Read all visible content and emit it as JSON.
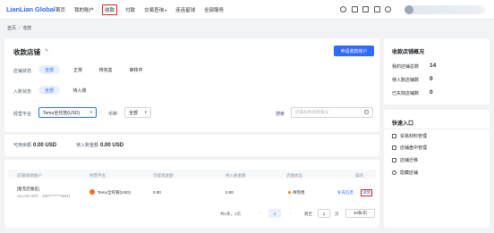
{
  "header": {
    "logo": "LianLian Global",
    "nav": [
      {
        "label": "首页"
      },
      {
        "label": "我的账户"
      },
      {
        "label": "收款"
      },
      {
        "label": "付款"
      },
      {
        "label": "交易查询",
        "caret": "▾"
      },
      {
        "label": "连连星球"
      },
      {
        "label": "全部服务"
      }
    ]
  },
  "breadcrumb": {
    "home": "首页",
    "sep": "/",
    "current": "收款"
  },
  "main": {
    "title": "收款店铺",
    "edit_icon": "✎",
    "apply_button": "申请收款账户",
    "filters": {
      "shop_status_label": "店铺状态",
      "shop_status_options": [
        "全部",
        "正常",
        "待完善",
        "审核中"
      ],
      "entry_status_label": "入账状态",
      "entry_status_options": [
        "全部",
        "待入账"
      ],
      "platform_label": "经营平台",
      "platform_value": "Temu全托管(USD)",
      "currency_label": "币种",
      "currency_value": "全部",
      "search_label": "搜索",
      "search_placeholder": "店铺名称/收款账号"
    }
  },
  "summary": {
    "available_label": "可用余额",
    "available_value": "0.00 USD",
    "pending_label": "待入账金额",
    "pending_value": "0.00 USD"
  },
  "table": {
    "columns": [
      "店铺/收款账户",
      "经营平台",
      "可提现金额",
      "待入账金额",
      "店铺状态",
      "操作"
    ],
    "rows": [
      {
        "shop_name": "[暂无店铺名]",
        "account": "ALLAH WIT... 330********5821",
        "platform": "Temu全托管(USD)",
        "available": "0.00",
        "pending": "0.00",
        "status": "待完善",
        "action_complete": "补充信息",
        "action_detail": "详情"
      }
    ],
    "pagination": {
      "total": "共1条，1页",
      "page": "1",
      "jump_label": "跳至",
      "jump_value": "1",
      "page_unit": "页",
      "page_size": "10条/页"
    }
  },
  "sidebar": {
    "overview_title": "收款店铺概况",
    "stats": [
      {
        "label": "我的店铺总数",
        "value": "14"
      },
      {
        "label": "待入账店铺数",
        "value": "0"
      },
      {
        "label": "已失效店铺数",
        "value": "0"
      }
    ],
    "quick_title": "快速入口",
    "quick_links": [
      "贸易材料管理",
      "店铺盘中管理",
      "店铺迁移",
      "隐藏店铺"
    ]
  }
}
